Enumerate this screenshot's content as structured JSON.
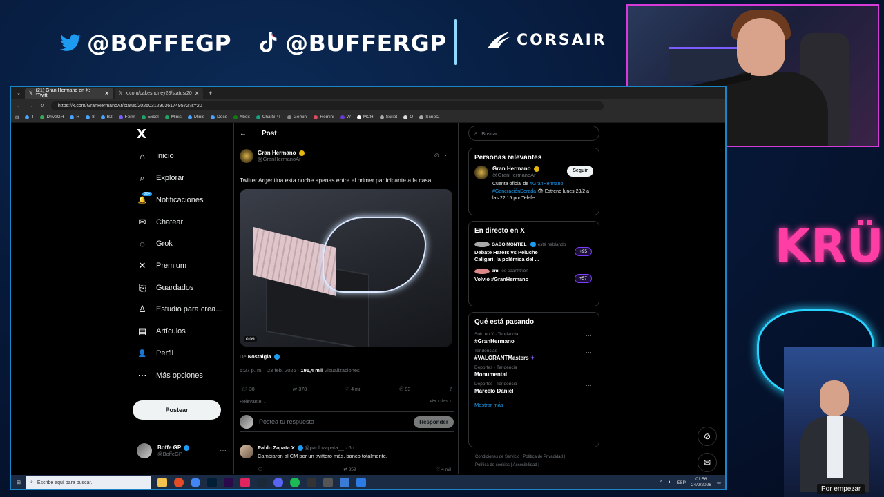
{
  "overlay": {
    "twitter_handle": "@BOFFEGP",
    "tiktok_handle": "@BUFFERGP",
    "sponsor": "CORSAIR",
    "team": "KRÜ",
    "tv_caption": "Por empezar"
  },
  "browser": {
    "tabs": [
      {
        "label": "(21) Gran Hermano en X: \"Twitt",
        "active": true
      },
      {
        "label": "x.com/cakeshoney28/status/20",
        "active": false
      }
    ],
    "url": "https://x.com/GranHermanoAr/status/2026031290361749572?s=20",
    "bookmarks": [
      "T",
      "DriveGH",
      "R",
      "8",
      "B2",
      "Form",
      "Excel",
      "Minis",
      "Minis",
      "Docs",
      "Xbox",
      "ChatGPT",
      "Gemini",
      "Remini",
      "W",
      "MCH",
      "Script",
      "O",
      "Script2"
    ]
  },
  "nav": {
    "logo": "X",
    "items": [
      {
        "label": "Inicio",
        "icon": "home-icon",
        "glyph": "⌂"
      },
      {
        "label": "Explorar",
        "icon": "search-icon",
        "glyph": "⌕"
      },
      {
        "label": "Notificaciones",
        "icon": "bell-icon",
        "glyph": "🔔",
        "badge": "20+"
      },
      {
        "label": "Chatear",
        "icon": "mail-icon",
        "glyph": "✉"
      },
      {
        "label": "Grok",
        "icon": "grok-icon",
        "glyph": "◌"
      },
      {
        "label": "Premium",
        "icon": "premium-icon",
        "glyph": "✕"
      },
      {
        "label": "Guardados",
        "icon": "bookmark-icon",
        "glyph": "⎘"
      },
      {
        "label": "Estudio para crea...",
        "icon": "studio-icon",
        "glyph": "♙"
      },
      {
        "label": "Artículos",
        "icon": "articles-icon",
        "glyph": "▤"
      },
      {
        "label": "Perfil",
        "icon": "profile-icon",
        "glyph": "👤"
      },
      {
        "label": "Más opciones",
        "icon": "more-icon",
        "glyph": "⋯"
      }
    ],
    "post_button": "Postear",
    "profile": {
      "name": "Boffe GP",
      "handle": "@BoffeGP"
    }
  },
  "post": {
    "header": "Post",
    "author": {
      "name": "Gran Hermano",
      "handle": "@GranHermanoAr"
    },
    "text": "Twitter Argentina esta noche apenas entre el primer participante a la casa",
    "video_duration": "0:09",
    "from_label": "De",
    "from_source": "Nostalgia",
    "time": "5:27 p. m. · 23 feb. 2026 ·",
    "views": "191,4 mil",
    "views_label": "Visualizaciones",
    "replies": "30",
    "reposts": "378",
    "likes": "4 mil",
    "bookmarks": "93",
    "relevance": "Relevante",
    "view_quotes": "Ver citas",
    "reply_placeholder": "Postea tu respuesta",
    "reply_button": "Responder"
  },
  "reply": {
    "name": "Pablo Zapata X",
    "handle": "@pablozapata__ · 6h",
    "text": "Cambiaron al CM por un twittero más, banco totalmente.",
    "reposts": "359",
    "likes": "4 mil"
  },
  "sidebar": {
    "search_placeholder": "Buscar",
    "relevant": {
      "title": "Personas relevantes",
      "name": "Gran Hermano",
      "handle": "@GranHermanoAr",
      "follow": "Seguir",
      "bio_prefix": "Cuenta oficial de",
      "bio_tag1": "#GranHermano",
      "bio_tag2": "#GeneraciónDorada",
      "bio_suffix": "👁 Estreno lunes 23/2 a las 22.15 por Telefe"
    },
    "live": {
      "title": "En directo en X",
      "items": [
        {
          "host": "GABO MONTIEL",
          "status": "está hablando",
          "title": "Debate Haters vs Peluche Caligari, la polémica del ...",
          "count": "+95"
        },
        {
          "host": "emi",
          "status": "es coanfitrión",
          "title": "Volvió #GranHermano",
          "count": "+57"
        }
      ]
    },
    "trends": {
      "title": "Qué está pasando",
      "items": [
        {
          "context": "Solo en X · Tendencia",
          "name": "#GranHermano"
        },
        {
          "context": "Tendencias",
          "name": "#VALORANTMasters"
        },
        {
          "context": "Deportes · Tendencia",
          "name": "Monumental"
        },
        {
          "context": "Deportes · Tendencia",
          "name": "Marcelo Daniel"
        }
      ],
      "show_more": "Mostrar más"
    },
    "footer": [
      "Condiciones de Servicio",
      "Política de Privacidad",
      "Política de cookies",
      "Accesibilidad"
    ]
  },
  "taskbar": {
    "search_placeholder": "Escribe aquí para buscar.",
    "lang": "ESP",
    "time": "01:56",
    "date": "24/2/2026"
  }
}
